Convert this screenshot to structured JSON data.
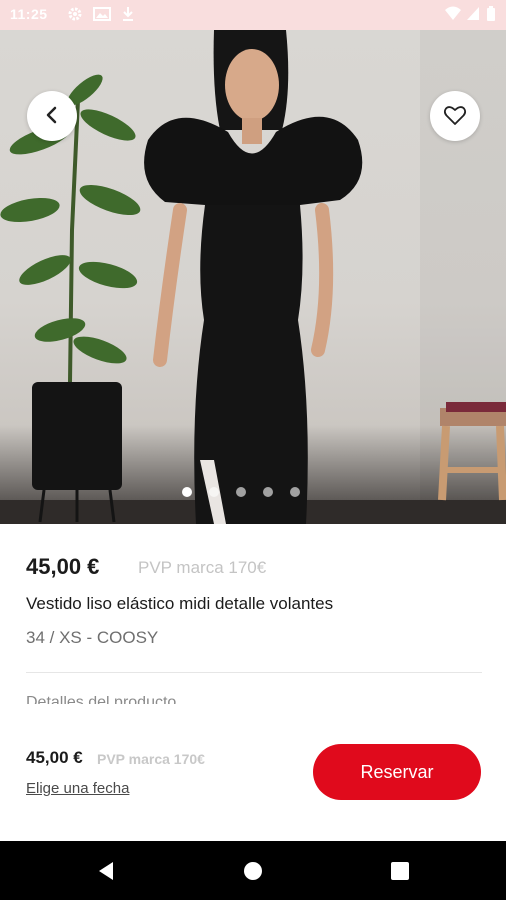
{
  "status_bar": {
    "time": "11:25"
  },
  "product": {
    "price": "45,00 €",
    "pvp": "PVP marca 170€",
    "title": "Vestido liso elástico midi detalle volantes",
    "size_brand": "34 / XS - COOSY",
    "section_peek": "Detalles del producto"
  },
  "gallery": {
    "image_count": 5,
    "active_index": 0
  },
  "bottom_bar": {
    "price": "45,00 €",
    "pvp": "PVP marca 170€",
    "date_link": "Elige una fecha",
    "reserve_label": "Reservar"
  },
  "icons": {
    "back": "chevron-left-icon",
    "favorite": "heart-outline-icon",
    "nav_back": "triangle-back-icon",
    "nav_home": "circle-home-icon",
    "nav_recents": "square-recents-icon"
  },
  "colors": {
    "accent": "#e00a1c",
    "status_bar": "#f9dede",
    "nav_bar": "#000000"
  }
}
